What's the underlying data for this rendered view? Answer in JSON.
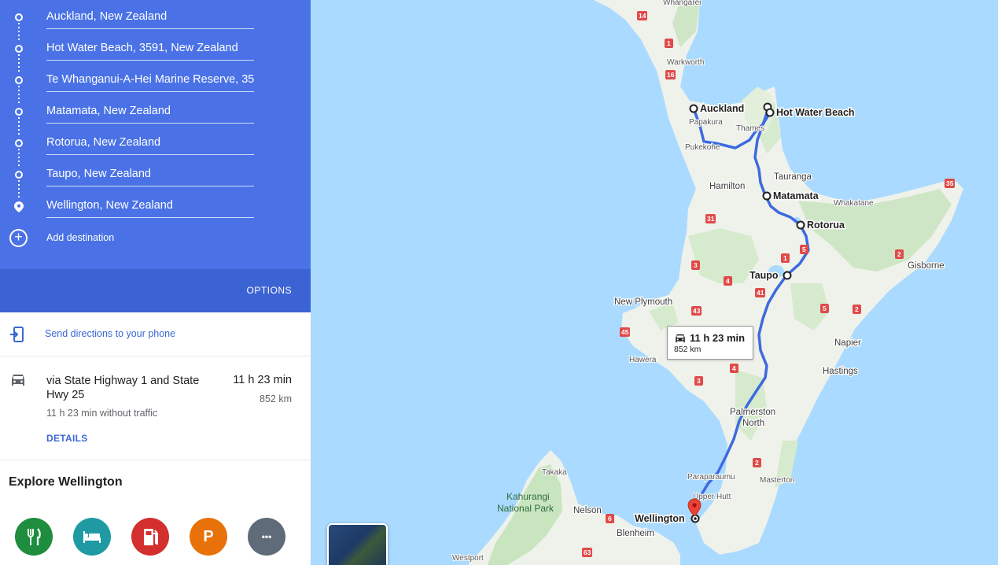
{
  "waypoints": [
    {
      "value": "Auckland, New Zealand",
      "icon": "circle-icon"
    },
    {
      "value": "Hot Water Beach, 3591, New Zealand",
      "icon": "circle-icon"
    },
    {
      "value": "Te Whanganui-A-Hei Marine Reserve, 35",
      "icon": "circle-icon"
    },
    {
      "value": "Matamata, New Zealand",
      "icon": "circle-icon"
    },
    {
      "value": "Rotorua, New Zealand",
      "icon": "circle-icon"
    },
    {
      "value": "Taupo, New Zealand",
      "icon": "circle-icon"
    },
    {
      "value": "Wellington, New Zealand",
      "icon": "pin-icon"
    }
  ],
  "add_destination": "Add destination",
  "options_label": "OPTIONS",
  "send_directions": "Send directions to your phone",
  "route": {
    "via": "via State Highway 1 and State Hwy 25",
    "duration": "11 h 23 min",
    "distance": "852 km",
    "traffic_note": "11 h 23 min without traffic",
    "details_label": "DETAILS"
  },
  "explore": {
    "title": "Explore Wellington",
    "categories": [
      {
        "name": "restaurants",
        "icon": "fork-knife-icon",
        "color": "#1e8e3e"
      },
      {
        "name": "hotels",
        "icon": "bed-icon",
        "color": "#1f9aa3"
      },
      {
        "name": "gas",
        "icon": "gas-pump-icon",
        "color": "#d32f2f"
      },
      {
        "name": "parking",
        "icon": "parking-icon",
        "color": "#e8710a",
        "glyph": "P"
      },
      {
        "name": "more",
        "icon": "more-icon",
        "color": "#5f6b78",
        "glyph": "•••"
      }
    ]
  },
  "map": {
    "route_tooltip": {
      "duration": "11 h 23 min",
      "distance": "852 km"
    },
    "stop_labels": [
      "Auckland",
      "Hot Water Beach",
      "Matamata",
      "Rotorua",
      "Taupo",
      "Wellington"
    ],
    "place_labels": [
      "Whangarei",
      "Warkworth",
      "Papakura",
      "Pukekohe",
      "Thames",
      "Tauranga",
      "Hamilton",
      "Whakatane",
      "Gisborne",
      "New Plymouth",
      "Napier",
      "Hastings",
      "Hawera",
      "Palmerston",
      "North",
      "Paraparaumu",
      "Masterton",
      "Upper Hutt",
      "Takaka",
      "Kahurangi",
      "National Park",
      "Nelson",
      "Blenheim",
      "Westport"
    ],
    "road_shields": [
      "14",
      "1",
      "16",
      "35",
      "2",
      "31",
      "3",
      "4",
      "1",
      "5",
      "41",
      "43",
      "45",
      "5",
      "2",
      "4",
      "3",
      "2",
      "6",
      "63"
    ],
    "colors": {
      "water": "#aadaff",
      "land": "#f1f3ef",
      "forest": "#c9e5c0",
      "route": "#4a72e6",
      "pin": "#ea4335"
    }
  }
}
